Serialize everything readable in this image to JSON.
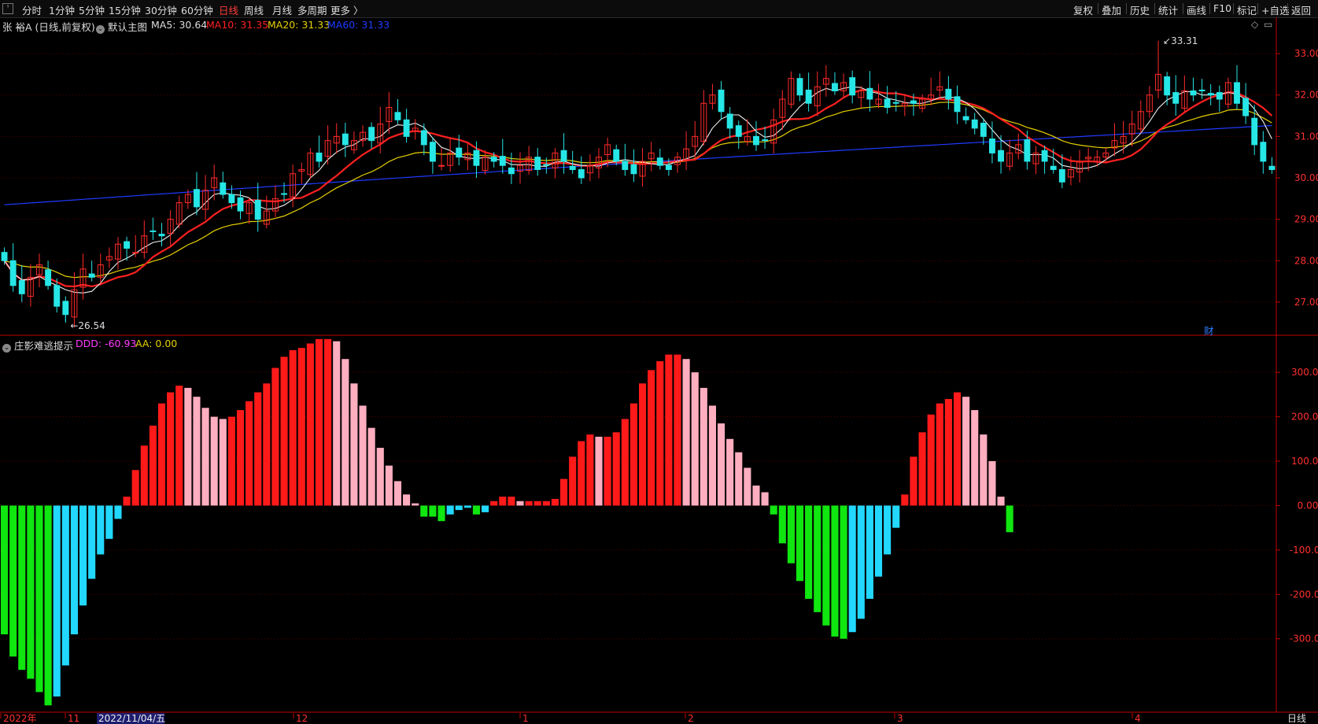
{
  "toolbar": {
    "left": [
      {
        "label": "分时",
        "active": false
      },
      {
        "label": "1分钟",
        "active": false
      },
      {
        "label": "5分钟",
        "active": false
      },
      {
        "label": "15分钟",
        "active": false
      },
      {
        "label": "30分钟",
        "active": false
      },
      {
        "label": "60分钟",
        "active": false
      },
      {
        "label": "日线",
        "active": true
      },
      {
        "label": "周线",
        "active": false
      },
      {
        "label": "月线",
        "active": false
      },
      {
        "label": "多周期",
        "active": false
      },
      {
        "label": "更多 〉",
        "active": false
      }
    ],
    "right": [
      "复权",
      "叠加",
      "历史",
      "统计",
      "画线",
      "F10",
      "标记",
      "+自选",
      "返回"
    ]
  },
  "main_header": {
    "stock": "张 裕A (日线,前复权)",
    "template": "默认主图",
    "ma5": "MA5: 30.64",
    "ma10": "MA10: 31.35",
    "ma20": "MA20: 31.33",
    "ma60": "MA60: 31.33"
  },
  "indicator_header": {
    "name": "庄影难逃提示",
    "ddd": "DDD: -60.93",
    "aa": "AA: 0.00"
  },
  "colors": {
    "up": "#ff2a2a",
    "down": "#26e6e6",
    "ma5": "#f0f0f0",
    "ma10": "#ff2020",
    "ma20": "#e6d000",
    "ma60": "#1f3bff",
    "bar_red": "#ff1a1a",
    "bar_pink": "#ffaec0",
    "bar_green": "#10e610",
    "bar_cyan": "#22d8ff",
    "axis": "#c00000"
  },
  "annotations": {
    "high": "33.31",
    "low": "26.54",
    "fin_icon": "财"
  },
  "bottom_axis": {
    "dates": [
      "2022年",
      "11",
      "2022/11/04/五",
      "12",
      "1",
      "2",
      "3",
      "4"
    ],
    "period": "日线"
  },
  "chart_data": [
    {
      "type": "candlestick",
      "title": "张 裕A (日线,前复权)",
      "ylim": [
        26.2,
        33.8
      ],
      "yticks": [
        "33.00",
        "32.00",
        "31.00",
        "30.00",
        "29.00",
        "28.00",
        "27.00"
      ],
      "closes": [
        28.0,
        27.4,
        27.2,
        27.6,
        27.9,
        27.4,
        26.9,
        26.7,
        27.3,
        27.8,
        27.6,
        27.9,
        28.1,
        28.4,
        28.3,
        28.2,
        28.6,
        28.7,
        28.6,
        29.0,
        29.4,
        29.6,
        29.3,
        29.7,
        30.0,
        29.6,
        29.4,
        29.2,
        29.4,
        29.0,
        29.2,
        29.5,
        29.6,
        30.1,
        30.2,
        30.6,
        30.4,
        30.9,
        31.0,
        30.8,
        30.9,
        31.1,
        30.9,
        31.3,
        31.7,
        31.4,
        31.0,
        31.2,
        30.8,
        30.4,
        30.3,
        30.6,
        30.5,
        30.6,
        30.3,
        30.5,
        30.4,
        30.3,
        30.1,
        30.3,
        30.5,
        30.2,
        30.3,
        30.6,
        30.4,
        30.2,
        30.0,
        30.3,
        30.5,
        30.8,
        30.4,
        30.2,
        30.1,
        30.4,
        30.6,
        30.3,
        30.2,
        30.5,
        30.7,
        31.0,
        31.8,
        32.0,
        31.6,
        31.2,
        31.0,
        31.0,
        30.8,
        30.9,
        31.4,
        31.9,
        32.4,
        32.0,
        31.8,
        32.2,
        32.4,
        32.1,
        32.3,
        32.0,
        32.1,
        31.9,
        31.9,
        31.7,
        31.8,
        31.8,
        31.8,
        31.9,
        32.0,
        32.2,
        31.9,
        31.6,
        31.4,
        31.2,
        31.0,
        30.6,
        30.4,
        30.6,
        30.8,
        30.4,
        30.6,
        30.4,
        30.2,
        29.9,
        30.2,
        30.4,
        30.5,
        30.5,
        30.6,
        30.9,
        31.0,
        31.3,
        31.6,
        32.0,
        32.5,
        32.0,
        31.8,
        32.1,
        32.0,
        32.1,
        32.0,
        31.9,
        32.3,
        31.8,
        31.5,
        30.8,
        30.4,
        30.2
      ]
    },
    {
      "type": "bar",
      "title": "庄影难逃提示",
      "ylim": [
        -460,
        380
      ],
      "yticks": [
        "300.00",
        "200.00",
        "100.00",
        "0.00",
        "-100.00",
        "-200.00",
        "-300.00"
      ],
      "values": [
        -290,
        -340,
        -370,
        -390,
        -420,
        -450,
        -430,
        -360,
        -290,
        -225,
        -165,
        -110,
        -75,
        -30,
        20,
        80,
        135,
        180,
        230,
        255,
        270,
        265,
        245,
        220,
        200,
        195,
        200,
        215,
        235,
        255,
        275,
        310,
        335,
        350,
        355,
        365,
        375,
        375,
        370,
        330,
        275,
        225,
        175,
        130,
        90,
        55,
        25,
        5,
        -25,
        -25,
        -35,
        -20,
        -10,
        -5,
        -20,
        -15,
        10,
        20,
        20,
        10,
        10,
        10,
        10,
        15,
        60,
        110,
        145,
        160,
        155,
        155,
        165,
        195,
        230,
        275,
        305,
        325,
        340,
        340,
        330,
        300,
        265,
        225,
        185,
        150,
        120,
        85,
        45,
        30,
        -20,
        -85,
        -130,
        -170,
        -210,
        -240,
        -270,
        -295,
        -300,
        -285,
        -255,
        -210,
        -160,
        -110,
        -50,
        25,
        110,
        165,
        205,
        230,
        240,
        255,
        245,
        215,
        160,
        100,
        20,
        -60
      ]
    }
  ]
}
